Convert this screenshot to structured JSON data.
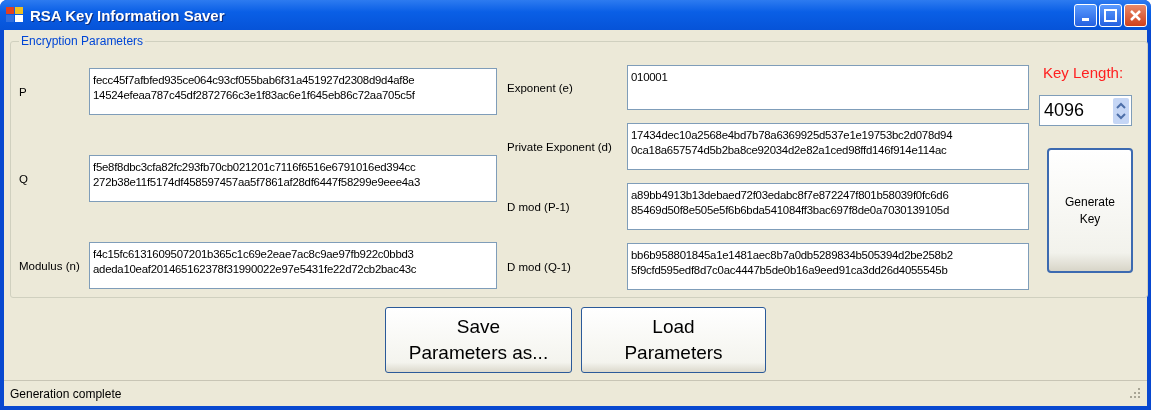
{
  "window": {
    "title": "RSA Key Information Saver"
  },
  "group": {
    "title": "Encryption Parameters"
  },
  "left_fields": [
    {
      "label": "P",
      "value": "fecc45f7afbfed935ce064c93cf055bab6f31a451927d2308d9d4af8e\n14524efeaa787c45df2872766c3e1f83ac6e1f645eb86c72aa705c5f"
    },
    {
      "label": "Q",
      "value": "f5e8f8dbc3cfa82fc293fb70cb021201c7116f6516e6791016ed394cc\n272b38e11f5174df458597457aa5f7861af28df6447f58299e9eee4a3"
    },
    {
      "label": "Modulus (n)",
      "value": "f4c15fc6131609507201b365c1c69e2eae7ac8c9ae97fb922c0bbd3\nadeda10eaf201465162378f31990022e97e5431fe22d72cb2bac43c"
    }
  ],
  "right_fields": [
    {
      "label": "Exponent (e)",
      "value": "010001"
    },
    {
      "label": "Private Exponent (d)",
      "value": "17434dec10a2568e4bd7b78a6369925d537e1e19753bc2d078d94\n0ca18a657574d5b2ba8ce92034d2e82a1ced98ffd146f914e114ac"
    },
    {
      "label": "D mod (P-1)",
      "value": "a89bb4913b13debaed72f03edabc8f7e872247f801b58039f0fc6d6\n85469d50f8e505e5f6b6bda541084ff3bac697f8de0a7030139105d"
    },
    {
      "label": "D mod (Q-1)",
      "value": "bb6b958801845a1e1481aec8b7a0db5289834b505394d2be258b2\n5f9cfd595edf8d7c0ac4447b5de0b16a9eed91ca3dd26d4055545b"
    }
  ],
  "key_length": {
    "label": "Key Length:",
    "value": "4096"
  },
  "generate_button": "Generate\nKey",
  "buttons": [
    "Save\nParameters as...",
    "Load\nParameters"
  ],
  "status_bar": "Generation complete"
}
